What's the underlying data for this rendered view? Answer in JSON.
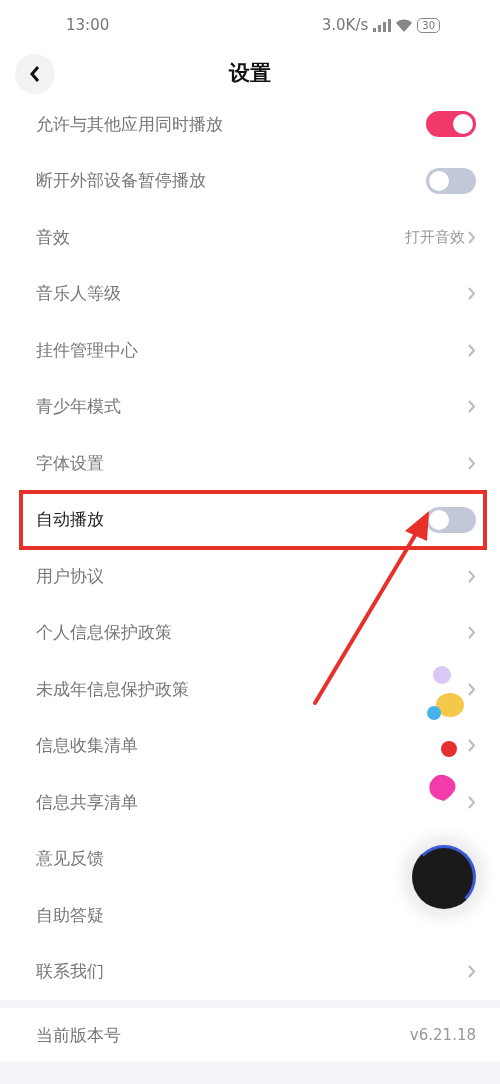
{
  "status_bar": {
    "time": "13:00",
    "speed": "3.0K/s",
    "battery": "30"
  },
  "header": {
    "title": "设置"
  },
  "rows": [
    {
      "kind": "toggle",
      "label": "允许与其他应用同时播放",
      "on": true,
      "highlighted": false
    },
    {
      "kind": "toggle",
      "label": "断开外部设备暂停播放",
      "on": false,
      "highlighted": false
    },
    {
      "kind": "link",
      "label": "音效",
      "value": "打开音效",
      "highlighted": false
    },
    {
      "kind": "link",
      "label": "音乐人等级",
      "highlighted": false
    },
    {
      "kind": "link",
      "label": "挂件管理中心",
      "highlighted": false
    },
    {
      "kind": "link",
      "label": "青少年模式",
      "highlighted": false
    },
    {
      "kind": "link",
      "label": "字体设置",
      "highlighted": false
    },
    {
      "kind": "toggle",
      "label": "自动播放",
      "on": false,
      "highlighted": true
    },
    {
      "kind": "link",
      "label": "用户协议",
      "highlighted": false
    },
    {
      "kind": "link",
      "label": "个人信息保护政策",
      "highlighted": false
    },
    {
      "kind": "link",
      "label": "未成年信息保护政策",
      "highlighted": false
    },
    {
      "kind": "link",
      "label": "信息收集清单",
      "highlighted": false
    },
    {
      "kind": "link",
      "label": "信息共享清单",
      "highlighted": false
    },
    {
      "kind": "plain",
      "label": "意见反馈",
      "highlighted": false
    },
    {
      "kind": "plain",
      "label": "自助答疑",
      "highlighted": false
    },
    {
      "kind": "link",
      "label": "联系我们",
      "highlighted": false
    }
  ],
  "version": {
    "label": "当前版本号",
    "value": "v6.21.18"
  }
}
